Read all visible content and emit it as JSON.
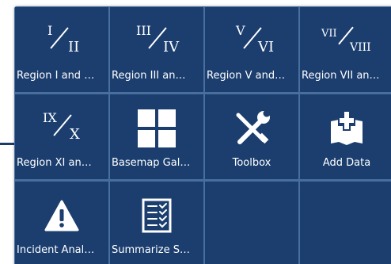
{
  "tiles": [
    {
      "label": "Region I and …",
      "icon": "fraction-icon",
      "numerator": "I",
      "denominator": "II"
    },
    {
      "label": "Region III an…",
      "icon": "fraction-icon",
      "numerator": "III",
      "denominator": "IV"
    },
    {
      "label": "Region V and…",
      "icon": "fraction-icon",
      "numerator": "V",
      "denominator": "VI"
    },
    {
      "label": "Region VII an…",
      "icon": "fraction-icon",
      "numerator": "VII",
      "denominator": "VIII"
    },
    {
      "label": "Region XI an…",
      "icon": "fraction-icon",
      "numerator": "IX",
      "denominator": "X"
    },
    {
      "label": "Basemap Gal…",
      "icon": "grid-icon"
    },
    {
      "label": "Toolbox",
      "icon": "wrench-screwdriver-icon"
    },
    {
      "label": "Add Data",
      "icon": "add-data-icon"
    },
    {
      "label": "Incident Anal…",
      "icon": "warning-icon"
    },
    {
      "label": "Summarize S…",
      "icon": "checklist-icon"
    }
  ],
  "colors": {
    "tile_background": "#1b3e6f",
    "panel_background": "#486f9d",
    "text": "#ffffff"
  }
}
